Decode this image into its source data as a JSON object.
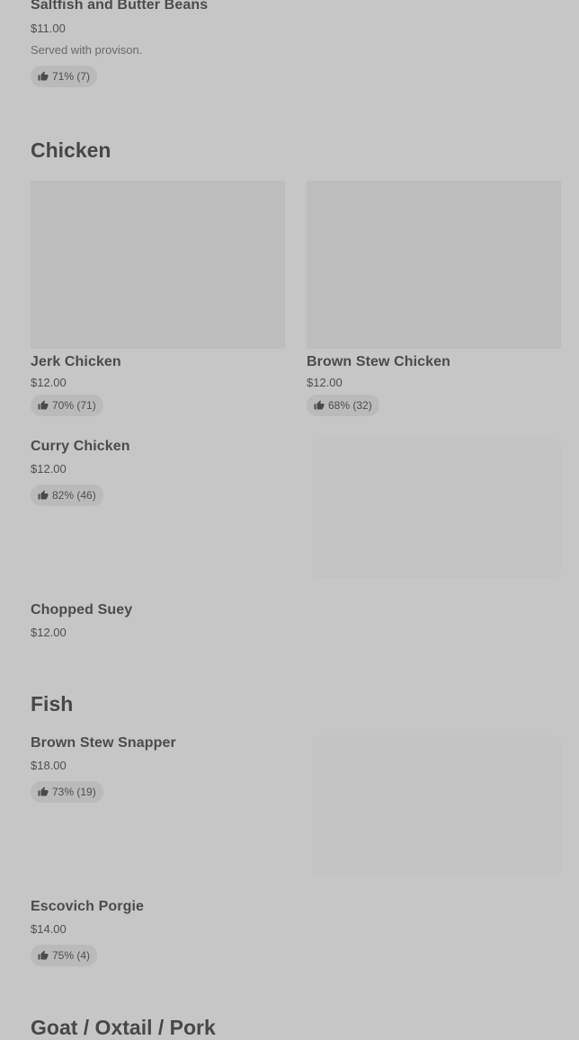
{
  "sections": {
    "top": {
      "items": [
        {
          "name": "Saltfish and Butter Beans",
          "price": "$11.00",
          "description": "Served with provison.",
          "rating": "71% (7)"
        }
      ]
    },
    "chicken": {
      "title": "Chicken",
      "items": [
        {
          "name": "Jerk Chicken",
          "price": "$12.00",
          "rating": "70% (71)"
        },
        {
          "name": "Brown Stew Chicken",
          "price": "$12.00",
          "rating": "68% (32)"
        },
        {
          "name": "Curry Chicken",
          "price": "$12.00",
          "rating": "82% (46)"
        },
        {
          "name": "Chopped Suey",
          "price": "$12.00"
        }
      ]
    },
    "fish": {
      "title": "Fish",
      "items": [
        {
          "name": "Brown Stew Snapper",
          "price": "$18.00",
          "rating": "73% (19)"
        },
        {
          "name": "Escovich Porgie",
          "price": "$14.00",
          "rating": "75% (4)"
        }
      ]
    },
    "goat": {
      "title": "Goat / Oxtail / Pork"
    }
  },
  "icons": {
    "rating": "thumbs-up-icon"
  }
}
